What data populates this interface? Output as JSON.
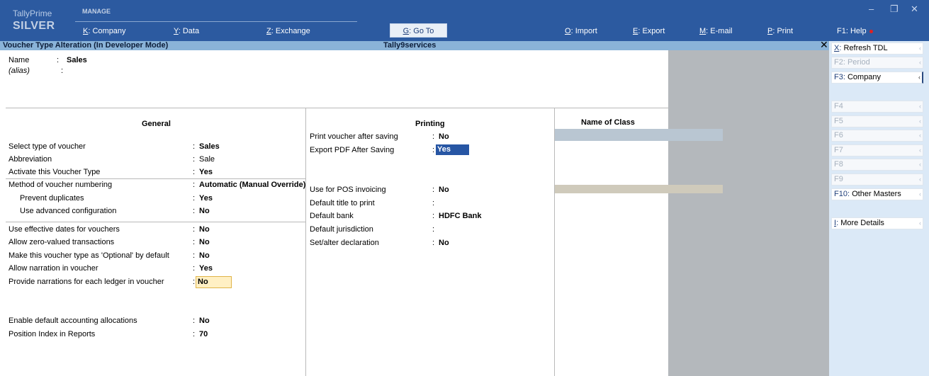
{
  "top": {
    "brand_top": "TallyPrime",
    "brand_edition": "SILVER",
    "section": "MANAGE",
    "menu": [
      {
        "key": "K",
        "label": "Company"
      },
      {
        "key": "Y",
        "label": "Data"
      },
      {
        "key": "Z",
        "label": "Exchange"
      },
      {
        "key": "G",
        "label": "Go To"
      },
      {
        "key": "O",
        "label": "Import"
      },
      {
        "key": "E",
        "label": "Export"
      },
      {
        "key": "M",
        "label": "E-mail"
      },
      {
        "key": "P",
        "label": "Print"
      },
      {
        "key": "F1",
        "label": "Help"
      }
    ],
    "window_controls": [
      "minimize",
      "restore",
      "close"
    ]
  },
  "titlebar": {
    "title": "Voucher Type Alteration (In Developer Mode)",
    "company": "Tally9services"
  },
  "header": {
    "name_label": "Name",
    "name_value": "Sales",
    "alias_label": "(alias)",
    "alias_value": ""
  },
  "general": {
    "heading": "General",
    "rows": [
      {
        "label": "Select type of voucher",
        "value": "Sales",
        "bold": true
      },
      {
        "label": "Abbreviation",
        "value": "Sale",
        "bold": false
      },
      {
        "label": "Activate this Voucher Type",
        "value": "Yes",
        "bold": true
      },
      {
        "label": "Method of voucher numbering",
        "value": "Automatic (Manual Override)",
        "bold": true
      },
      {
        "label": "Prevent duplicates",
        "value": "Yes",
        "bold": true
      },
      {
        "label": "Use advanced configuration",
        "value": "No",
        "bold": true
      },
      {
        "label": "Use effective dates for vouchers",
        "value": "No",
        "bold": true
      },
      {
        "label": "Allow zero-valued transactions",
        "value": "No",
        "bold": true
      },
      {
        "label": "Make this voucher type as 'Optional' by default",
        "value": "No",
        "bold": true
      },
      {
        "label": "Allow narration in voucher",
        "value": "Yes",
        "bold": true
      },
      {
        "label": "Provide narrations for each ledger in voucher",
        "value": "No",
        "bold": true
      },
      {
        "label": "Enable default accounting allocations",
        "value": "No",
        "bold": true
      },
      {
        "label": "Position Index in Reports",
        "value": "70",
        "bold": true
      }
    ]
  },
  "printing": {
    "heading": "Printing",
    "rows": [
      {
        "label": "Print voucher after saving",
        "value": "No"
      },
      {
        "label": "Export PDF After Saving",
        "value": "Yes"
      },
      {
        "label": "Use for POS invoicing",
        "value": "No"
      },
      {
        "label": "Default title to print",
        "value": ""
      },
      {
        "label": "Default bank",
        "value": "HDFC Bank"
      },
      {
        "label": "Default jurisdiction",
        "value": ""
      },
      {
        "label": "Set/alter declaration",
        "value": "No"
      }
    ]
  },
  "class": {
    "heading": "Name of Class"
  },
  "right_panel": [
    {
      "key": "X",
      "label": "Refresh TDL",
      "enabled": true
    },
    {
      "key": "F2",
      "label": "Period",
      "enabled": false
    },
    {
      "key": "F3",
      "label": "Company",
      "enabled": true
    },
    {
      "key": "F4",
      "label": "",
      "enabled": false
    },
    {
      "key": "F5",
      "label": "",
      "enabled": false
    },
    {
      "key": "F6",
      "label": "",
      "enabled": false
    },
    {
      "key": "F7",
      "label": "",
      "enabled": false
    },
    {
      "key": "F8",
      "label": "",
      "enabled": false
    },
    {
      "key": "F9",
      "label": "",
      "enabled": false
    },
    {
      "key": "F10",
      "label": "Other Masters",
      "enabled": true
    },
    {
      "key": "I",
      "label": "More Details",
      "enabled": true
    }
  ],
  "colors": {
    "topbar": "#2c5aa0",
    "titlebar": "#8ab3d8",
    "panel": "#dbe9f7",
    "highlight": "#2756a4",
    "focus_field": "#fff0c4"
  }
}
